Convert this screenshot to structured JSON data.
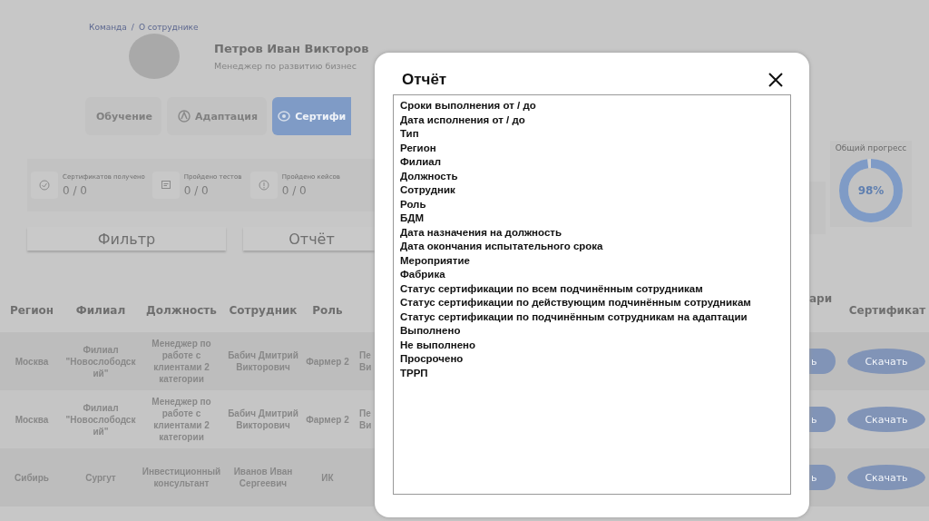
{
  "breadcrumb": {
    "items": [
      "Команда",
      "О сотруднике"
    ],
    "separator": "/"
  },
  "profile": {
    "name": "Петров Иван Викторов",
    "position": "Менеджер по развитию бизнес"
  },
  "tabs": [
    {
      "label": "Обучение",
      "selected": false
    },
    {
      "label": "Адаптация",
      "selected": false
    },
    {
      "label": "Сертифи",
      "selected": true
    }
  ],
  "stats": [
    {
      "label": "Сертификатов получено",
      "value": "0 / 0"
    },
    {
      "label": "Пройдено тестов",
      "value": "0 / 0"
    },
    {
      "label": "Пройдено кейсов",
      "value": "0 / 0"
    }
  ],
  "progress": {
    "label": "Общий прогресс",
    "value": "98%",
    "level": 0.98
  },
  "actions": [
    "Фильтр",
    "Отчёт"
  ],
  "table": {
    "columns": [
      "Регион",
      "Филиал",
      "Должность",
      "Сотрудник",
      "Роль",
      "ари",
      "Сертификат"
    ],
    "rows": [
      {
        "cells": [
          "Москва",
          "Филиал \"Новослободский\"",
          "Менеджер по работе с клиентами 2 категории",
          "Бабич Дмитрий Викторович",
          "Фармер 2"
        ],
        "column_6": "Пе Ви",
        "column_7": "ь",
        "certificate": "Скачать"
      },
      {
        "cells": [
          "Москва",
          "Филиал \"Новослободский\"",
          "Менеджер по работе с клиентами 2 категории",
          "Бабич Дмитрий Викторович",
          "Фармер 2"
        ],
        "column_6": "Пе Ви",
        "column_7": "ь",
        "certificate": "Скачать"
      },
      {
        "cells": [
          "Сибирь",
          "Сургут",
          "Инвестиционный консультант",
          "Иванов Иван Сергеевич",
          "ИК"
        ],
        "column_7": "ь",
        "certificate": "Скачать"
      }
    ]
  },
  "dialog": {
    "title": "Отчёт",
    "items": [
      "Сроки выполнения от / до",
      "Дата исполнения от / до",
      "Тип",
      "Регион",
      "Филиал",
      "Должность",
      "Сотрудник",
      "Роль",
      "БДМ",
      "Дата назначения на должность",
      "Дата окончания испытательного срока",
      "Мероприятие",
      "Фабрика",
      "Статус сертификации по всем подчинённым сотрудникам",
      "Статус сертификации по действующим подчинённым сотрудникам",
      "Статус сертификации по подчинённым сотрудникам на адаптации",
      "Выполнено",
      "Не выполнено",
      "Просрочено",
      "ТРРП"
    ]
  }
}
